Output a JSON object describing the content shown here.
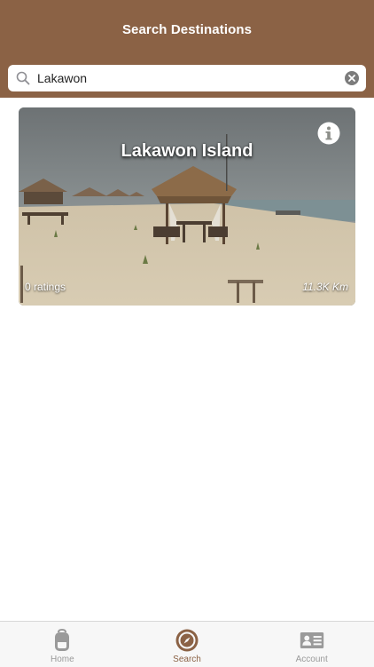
{
  "header": {
    "title": "Search Destinations"
  },
  "search": {
    "value": "Lakawon",
    "placeholder": ""
  },
  "results": [
    {
      "name": "Lakawon Island",
      "ratings": "0 ratings",
      "distance": "11.3K Km"
    }
  ],
  "tabs": [
    {
      "label": "Home",
      "icon": "backpack-icon",
      "active": false
    },
    {
      "label": "Search",
      "icon": "compass-icon",
      "active": true
    },
    {
      "label": "Account",
      "icon": "id-card-icon",
      "active": false
    }
  ],
  "colors": {
    "brand": "#8b6245",
    "inactive": "#9a9a9a"
  }
}
